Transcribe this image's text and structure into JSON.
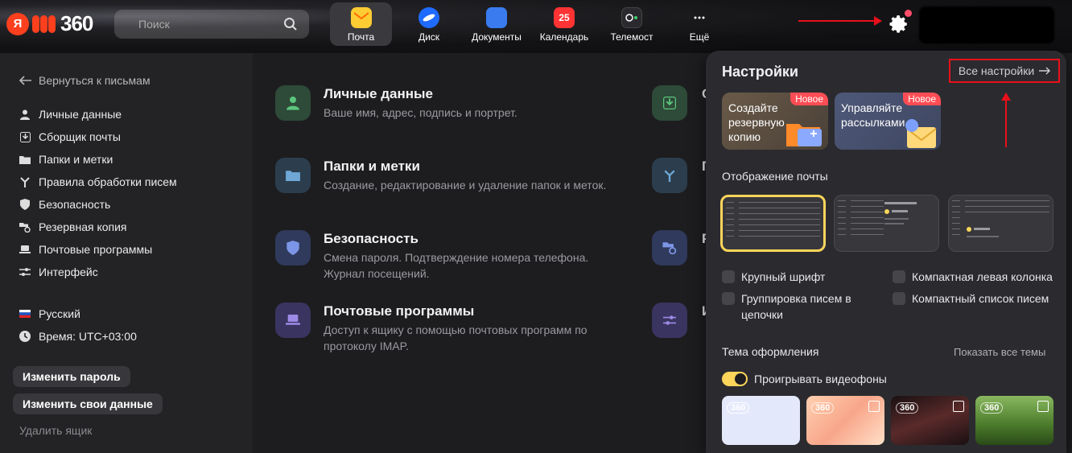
{
  "header": {
    "logo_ya": "Я",
    "logo_num": "360",
    "search_placeholder": "Поиск",
    "apps": [
      {
        "label": "Почта",
        "icon": "mail-icon",
        "color": "#ffcc33"
      },
      {
        "label": "Диск",
        "icon": "disk-icon",
        "color": "#1f6bff"
      },
      {
        "label": "Документы",
        "icon": "docs-icon",
        "color": "#3a7cf0"
      },
      {
        "label": "Календарь",
        "icon": "calendar-icon",
        "color": "#ff3333",
        "badge": "25"
      },
      {
        "label": "Телемост",
        "icon": "telemost-icon",
        "color": "#2a2a2e"
      },
      {
        "label": "Ещё",
        "icon": "more-icon",
        "color": "transparent"
      }
    ]
  },
  "sidebar": {
    "back": "Вернуться к письмам",
    "items": [
      {
        "label": "Личные данные",
        "icon": "person-icon"
      },
      {
        "label": "Сборщик почты",
        "icon": "inbox-download-icon"
      },
      {
        "label": "Папки и метки",
        "icon": "folder-icon"
      },
      {
        "label": "Правила обработки писем",
        "icon": "rules-icon"
      },
      {
        "label": "Безопасность",
        "icon": "shield-icon"
      },
      {
        "label": "Резервная копия",
        "icon": "backup-icon"
      },
      {
        "label": "Почтовые программы",
        "icon": "laptop-icon"
      },
      {
        "label": "Интерфейс",
        "icon": "sliders-icon"
      }
    ],
    "language": "Русский",
    "time": "Время: UTC+03:00",
    "change_password": "Изменить пароль",
    "change_data": "Изменить свои данные",
    "delete_box": "Удалить ящик"
  },
  "main": {
    "cards": [
      {
        "title": "Личные данные",
        "desc": "Ваше имя, адрес, подпись и портрет.",
        "icon": "person-icon",
        "color": "#2e4a38"
      },
      {
        "title": "Папки и метки",
        "desc": "Создание, редактирование и удаление папок и меток.",
        "icon": "folder-icon",
        "color": "#2c3e4e"
      },
      {
        "title": "Безопасность",
        "desc": "Смена пароля. Подтверждение номера телефона. Журнал посещений.",
        "icon": "shield-icon",
        "color": "#2f3a5c"
      },
      {
        "title": "Почтовые программы",
        "desc": "Доступ к ящику с помощью почтовых программ по протоколу IMAP.",
        "icon": "laptop-icon",
        "color": "#3a3460"
      }
    ],
    "right_cards": [
      {
        "title": "С",
        "icon": "inbox-download-icon",
        "color": "#2e4a38"
      },
      {
        "title": "П",
        "icon": "rules-icon",
        "color": "#2c3e4e"
      },
      {
        "title": "Р",
        "icon": "backup-icon",
        "color": "#2f3a5c"
      },
      {
        "title": "И",
        "icon": "sliders-icon",
        "color": "#3a3460"
      }
    ]
  },
  "panel": {
    "title": "Настройки",
    "all_settings": "Все настройки",
    "promos": [
      {
        "text": "Создайте резервную копию",
        "badge": "Новое",
        "color": "#5a4a3a"
      },
      {
        "text": "Управляйте рассылками",
        "badge": "Новое",
        "color": "#4a5268"
      }
    ],
    "mail_display": "Отображение почты",
    "options": [
      "Крупный шрифт",
      "Компактная левая колонка",
      "Группировка писем в цепочки",
      "Компактный список писем"
    ],
    "theme_header": "Тема оформления",
    "show_all_themes": "Показать все темы",
    "video_toggle": "Проигрывать видеофоны",
    "theme_label": "360"
  }
}
